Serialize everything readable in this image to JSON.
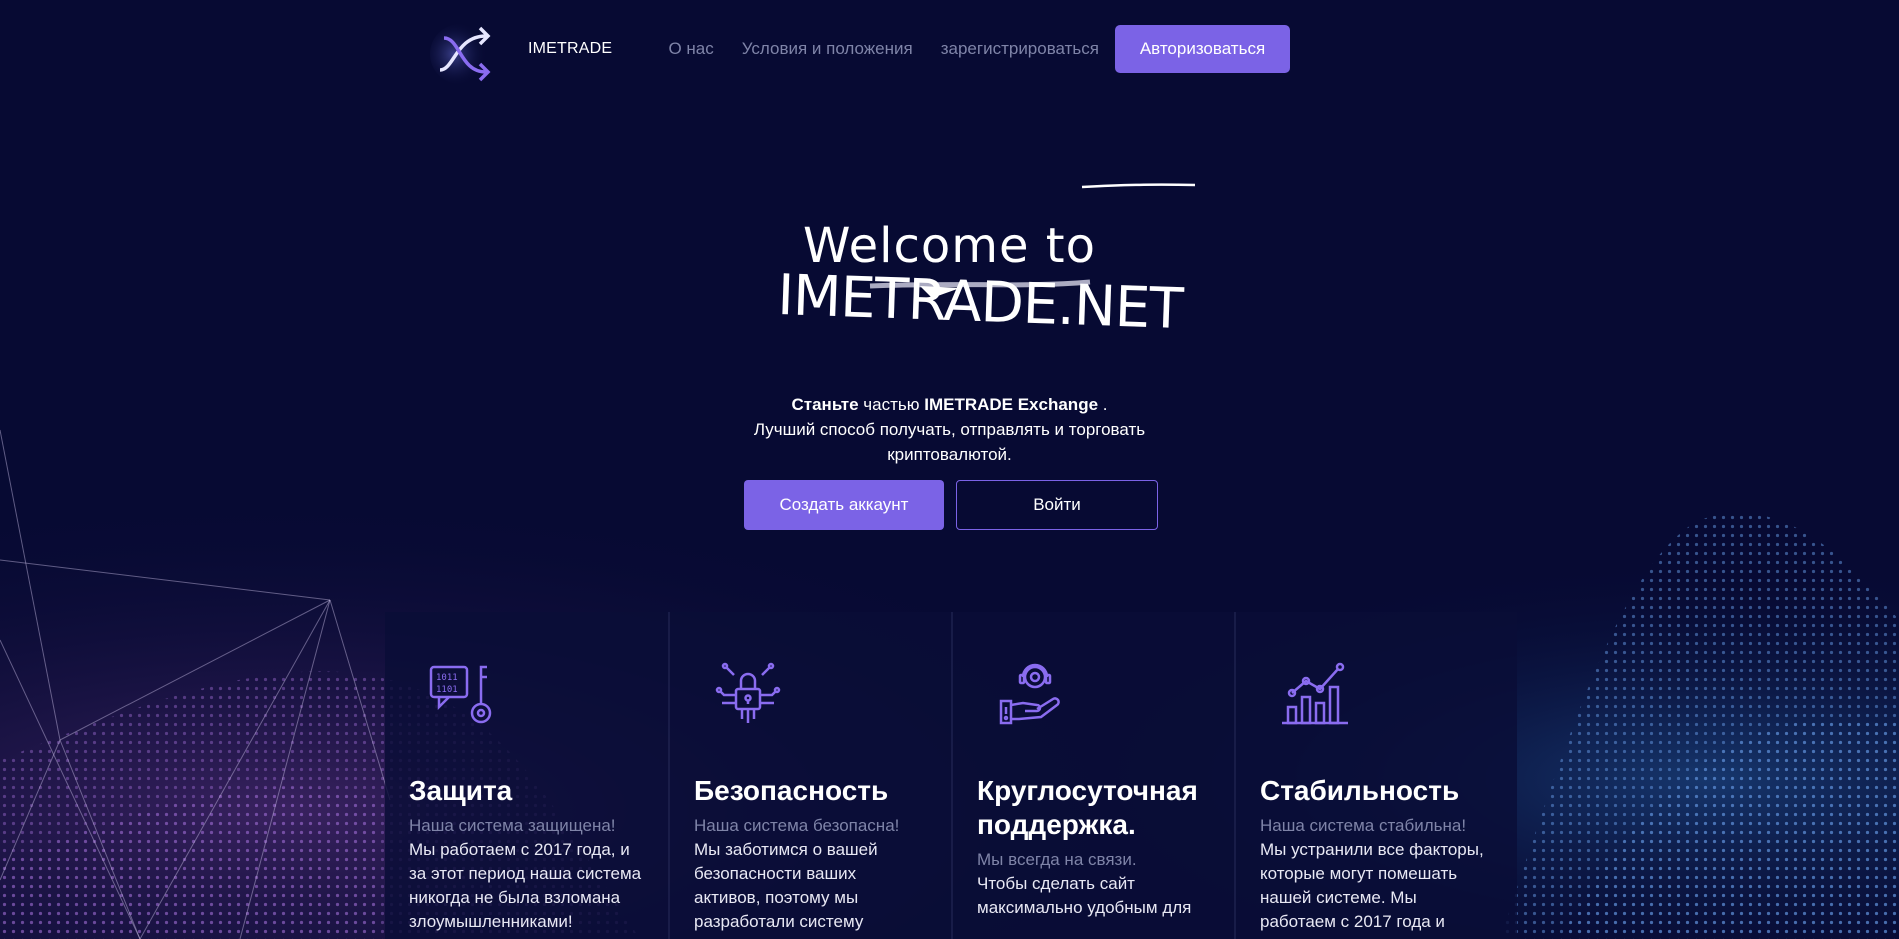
{
  "header": {
    "brand": "IMETRADE",
    "links": [
      "О нас",
      "Условия и положения",
      "зарегистрироваться"
    ],
    "cta": "Авторизоваться"
  },
  "hero": {
    "title_line1": "Welcome to",
    "title_line2": "IMETRADE.NET",
    "tagline_bold1": "Станьте",
    "tagline_mid": " частью ",
    "tagline_bold2": "IMETRADE Exchange",
    "tagline_end": " .",
    "tagline_line2": "Лучший способ получать, отправлять и торговать",
    "tagline_line3": "криптовалютой.",
    "primary_button": "Создать аккаунт",
    "secondary_button": "Войти"
  },
  "features": [
    {
      "icon": "binary-key-icon",
      "title": "Защита",
      "subtitle": "Наша система защищена!",
      "text": "Мы работаем с 2017 года, и за этот период наша система никогда не была взломана злоумышленниками!"
    },
    {
      "icon": "circuit-lock-icon",
      "title": "Безопасность",
      "subtitle": "Наша система безопасна!",
      "text": "Мы заботимся о вашей безопасности ваших активов, поэтому мы разработали систему"
    },
    {
      "icon": "support-gear-hand-icon",
      "title": "Круглосуточная поддержка.",
      "subtitle": "Мы всегда на связи.",
      "text": "Чтобы сделать сайт максимально удобным для"
    },
    {
      "icon": "growth-chart-icon",
      "title": "Стабильность",
      "subtitle": "Наша система стабильна!",
      "text": "Мы устранили все факторы, которые могут помешать нашей системе. Мы работаем с 2017 года и"
    }
  ],
  "colors": {
    "background": "#070a33",
    "accent": "#7b63e6",
    "muted": "#7f84a8"
  }
}
